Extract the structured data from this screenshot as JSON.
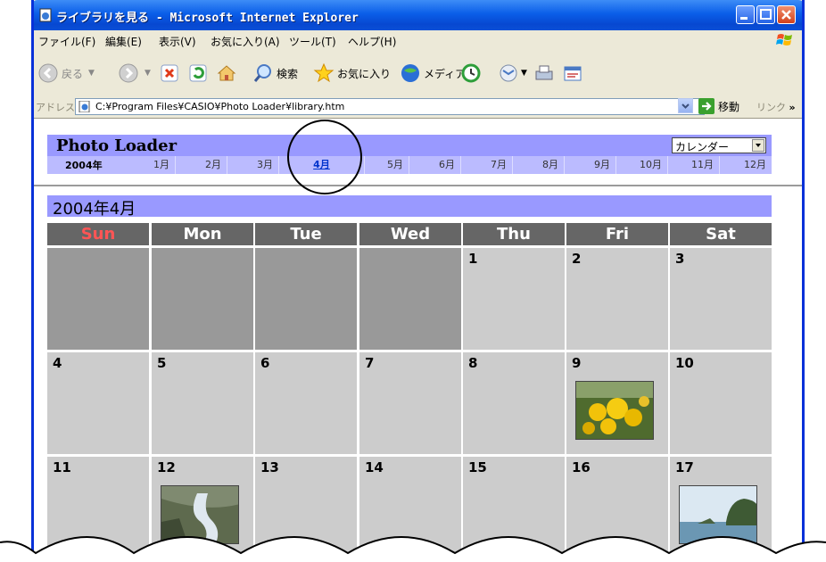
{
  "window": {
    "title": "ライブラリを見る - Microsoft Internet Explorer"
  },
  "menu": [
    "ファイル(F)",
    "編集(E)",
    "表示(V)",
    "お気に入り(A)",
    "ツール(T)",
    "ヘルプ(H)"
  ],
  "toolbar": {
    "back": "戻る",
    "search": "検索",
    "favorites": "お気に入り",
    "media": "メディア"
  },
  "address": {
    "label": "アドレス(D)",
    "url": "C:¥Program Files¥CASIO¥Photo Loader¥library.htm",
    "go": "移動",
    "links": "リンク"
  },
  "app": {
    "title": "Photo Loader",
    "view_select": "カレンダー",
    "year": "2004年",
    "months": [
      "1月",
      "2月",
      "3月",
      "4月",
      "5月",
      "6月",
      "7月",
      "8月",
      "9月",
      "10月",
      "11月",
      "12月"
    ],
    "selected_month": "4月"
  },
  "calendar": {
    "title": "2004年4月",
    "weekdays": [
      "Sun",
      "Mon",
      "Tue",
      "Wed",
      "Thu",
      "Fri",
      "Sat"
    ],
    "sunday_color": "#ff5555",
    "rows": [
      [
        "",
        "",
        "",
        "",
        "1",
        "2",
        "3"
      ],
      [
        "4",
        "5",
        "6",
        "7",
        "8",
        "9",
        "10"
      ],
      [
        "11",
        "12",
        "13",
        "14",
        "15",
        "16",
        "17"
      ]
    ]
  }
}
